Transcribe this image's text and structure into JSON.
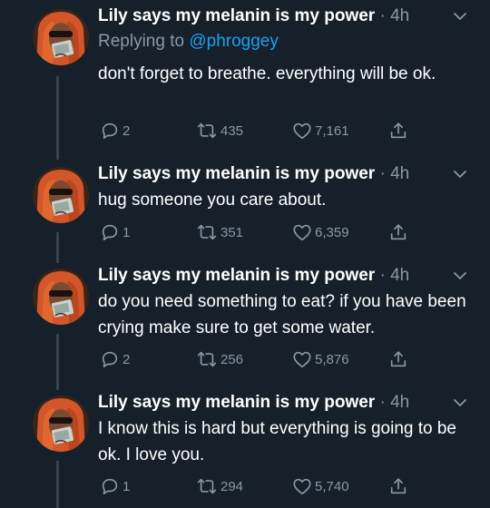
{
  "tweets": [
    {
      "name": "Lily says my melanin is my power",
      "time": "4h",
      "replying_prefix": "Replying to",
      "replying_handle": "@phroggey",
      "text": "don't forget to breathe. everything will be ok.",
      "replies": "2",
      "retweets": "435",
      "likes": "7,161"
    },
    {
      "name": "Lily says my melanin is my power",
      "time": "4h",
      "text": "hug someone you care about.",
      "replies": "1",
      "retweets": "351",
      "likes": "6,359"
    },
    {
      "name": "Lily says my melanin is my power",
      "time": "4h",
      "text": "do you need something to eat? if you have been crying make sure to get some water.",
      "replies": "2",
      "retweets": "256",
      "likes": "5,876"
    },
    {
      "name": "Lily says my melanin is my power",
      "time": "4h",
      "text": "I know this is hard but everything is going to be ok. I love you.",
      "replies": "1",
      "retweets": "294",
      "likes": "5,740"
    }
  ],
  "separator": "·",
  "colors": {
    "background": "#15202b",
    "muted": "#8899a6",
    "link": "#1da1f2",
    "thread_line": "#38444d"
  },
  "icons": {
    "reply": "reply-icon",
    "retweet": "retweet-icon",
    "like": "heart-icon",
    "share": "share-icon",
    "caret": "chevron-down-icon"
  }
}
